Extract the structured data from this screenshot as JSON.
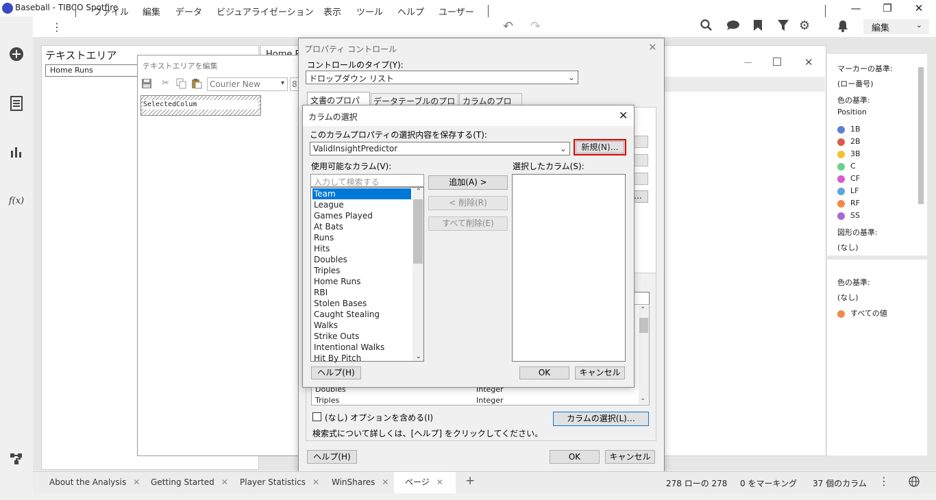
{
  "window": {
    "title": "Baseball - TIBCO Spotfire",
    "minimize": "—",
    "restore": "❐",
    "close": "✕"
  },
  "menubar": {
    "items": [
      "ファイル",
      "編集",
      "データ",
      "ビジュアライゼーション",
      "表示",
      "ツール",
      "ヘルプ",
      "ユーザー"
    ],
    "edit_mode": "編集"
  },
  "textarea_panel": {
    "title": "テキストエリア",
    "dropdown_value": "Home Runs",
    "second_header": "Home R"
  },
  "edit_textarea": {
    "title": "テキストエリアを編集",
    "font": "Courier New",
    "font_size": "8",
    "control_text": "SelectedColum"
  },
  "property_control": {
    "title": "プロパティ コントロール",
    "control_type_label": "コントロールのタイプ(Y):",
    "control_type_value": "ドロップダウン リスト",
    "tabs": [
      "文書のプロパティ",
      "データテーブルのプロパティ",
      "カラムのプロパティ"
    ],
    "rows": [
      {
        "name": "Doubles",
        "type": "Integer"
      },
      {
        "name": "Triples",
        "type": "Integer"
      }
    ],
    "include_none_label": "(なし) オプションを含める(I)",
    "search_help": "検索式について詳しくは、[ヘルプ] をクリックしてください。",
    "select_columns_button": "カラムの選択(L)…",
    "help_button": "ヘルプ(H)",
    "ok_button": "OK",
    "cancel_button": "キャンセル",
    "ellipsis_button": "…"
  },
  "column_select": {
    "title": "カラムの選択",
    "save_label": "このカラムプロパティの選択内容を保存する(T):",
    "save_value": "ValidInsightPredictor",
    "new_button": "新規(N)…",
    "available_label": "使用可能なカラム(V):",
    "search_placeholder": "入力して検索する",
    "available_columns": [
      "Team",
      "League",
      "Games Played",
      "At Bats",
      "Runs",
      "Hits",
      "Doubles",
      "Triples",
      "Home Runs",
      "RBI",
      "Stolen Bases",
      "Caught Stealing",
      "Walks",
      "Strike Outs",
      "Intentional Walks",
      "Hit By Pitch"
    ],
    "selected_label": "選択したカラム(S):",
    "add_button": "追加(A) >",
    "remove_button": "< 削除(R)",
    "remove_all_button": "すべて削除(E)",
    "help_button": "ヘルプ(H)",
    "ok_button": "OK",
    "cancel_button": "キャンセル"
  },
  "legend": {
    "marker_label": "マーカーの基準:",
    "marker_value": "(ロー番号)",
    "color_label": "色の基準:",
    "color_value": "Position",
    "positions": [
      {
        "name": "1B",
        "color": "#5b7fd9"
      },
      {
        "name": "2B",
        "color": "#e0574f"
      },
      {
        "name": "3B",
        "color": "#f2c230"
      },
      {
        "name": "C",
        "color": "#6ccf8a"
      },
      {
        "name": "CF",
        "color": "#d85ccd"
      },
      {
        "name": "LF",
        "color": "#5aa6e0"
      },
      {
        "name": "RF",
        "color": "#ef8a4a"
      },
      {
        "name": "SS",
        "color": "#a36ad6"
      }
    ],
    "shape_label": "図形の基準:",
    "shape_value": "(なし)",
    "color2_label": "色の基準:",
    "color2_value": "(なし)",
    "all_values": "すべての値",
    "all_values_color": "#ef8a4a"
  },
  "bottom_tabs": [
    "About the Analysis",
    "Getting Started",
    "Player Statistics",
    "WinShares",
    "ページ"
  ],
  "status": {
    "rows": "278 ローの 278",
    "marked": "0 をマーキング",
    "columns": "37 個のカラム"
  },
  "accent_color": "#0078d7",
  "highlight_color": "#e00000"
}
